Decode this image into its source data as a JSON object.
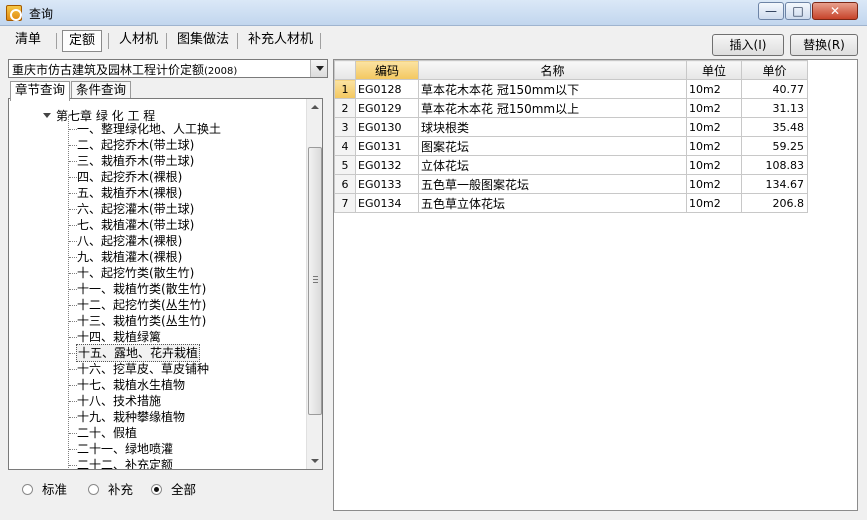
{
  "window": {
    "title": "查询",
    "min_glyph": "—",
    "max_glyph": "□",
    "close_glyph": "✕"
  },
  "tabs": [
    {
      "label": "清单"
    },
    {
      "label": "定额"
    },
    {
      "label": "人材机"
    },
    {
      "label": "图集做法"
    },
    {
      "label": "补充人材机"
    }
  ],
  "buttons": {
    "insert": "插入(I)",
    "replace": "替换(R)"
  },
  "quota_select": {
    "value": "重庆市仿古建筑及园林工程计价定额",
    "year": "(2008)"
  },
  "subtabs": [
    "章节查询",
    "条件查询"
  ],
  "tree": {
    "root": "第七章 绿 化 工 程",
    "items": [
      "一、整理绿化地、人工换土",
      "二、起挖乔木(带土球)",
      "三、栽植乔木(带土球)",
      "四、起挖乔木(裸根)",
      "五、栽植乔木(裸根)",
      "六、起挖灌木(带土球)",
      "七、栽植灌木(带土球)",
      "八、起挖灌木(裸根)",
      "九、栽植灌木(裸根)",
      "十、起挖竹类(散生竹)",
      "十一、栽植竹类(散生竹)",
      "十二、起挖竹类(丛生竹)",
      "十三、栽植竹类(丛生竹)",
      "十四、栽植绿篱",
      "十五、露地、花卉栽植",
      "十六、挖草皮、草皮铺种",
      "十七、栽植水生植物",
      "十八、技术措施",
      "十九、栽种攀缘植物",
      "二十、假植",
      "二十一、绿地喷灌",
      "二十二、补充定额"
    ],
    "selected_index": 14
  },
  "filter_radios": [
    {
      "label": "标准",
      "checked": false
    },
    {
      "label": "补充",
      "checked": false
    },
    {
      "label": "全部",
      "checked": true
    }
  ],
  "grid": {
    "headers": {
      "code": "编码",
      "name": "名称",
      "unit": "单位",
      "price": "单价"
    },
    "rows": [
      {
        "num": "1",
        "code": "EG0128",
        "name": "草本花木本花 冠150mm以下",
        "unit": "10m2",
        "price": "40.77"
      },
      {
        "num": "2",
        "code": "EG0129",
        "name": "草本花木本花 冠150mm以上",
        "unit": "10m2",
        "price": "31.13"
      },
      {
        "num": "3",
        "code": "EG0130",
        "name": "球块根类",
        "unit": "10m2",
        "price": "35.48"
      },
      {
        "num": "4",
        "code": "EG0131",
        "name": "图案花坛",
        "unit": "10m2",
        "price": "59.25"
      },
      {
        "num": "5",
        "code": "EG0132",
        "name": "立体花坛",
        "unit": "10m2",
        "price": "108.83"
      },
      {
        "num": "6",
        "code": "EG0133",
        "name": "五色草一般图案花坛",
        "unit": "10m2",
        "price": "134.67"
      },
      {
        "num": "7",
        "code": "EG0134",
        "name": "五色草立体花坛",
        "unit": "10m2",
        "price": "206.8"
      }
    ]
  }
}
